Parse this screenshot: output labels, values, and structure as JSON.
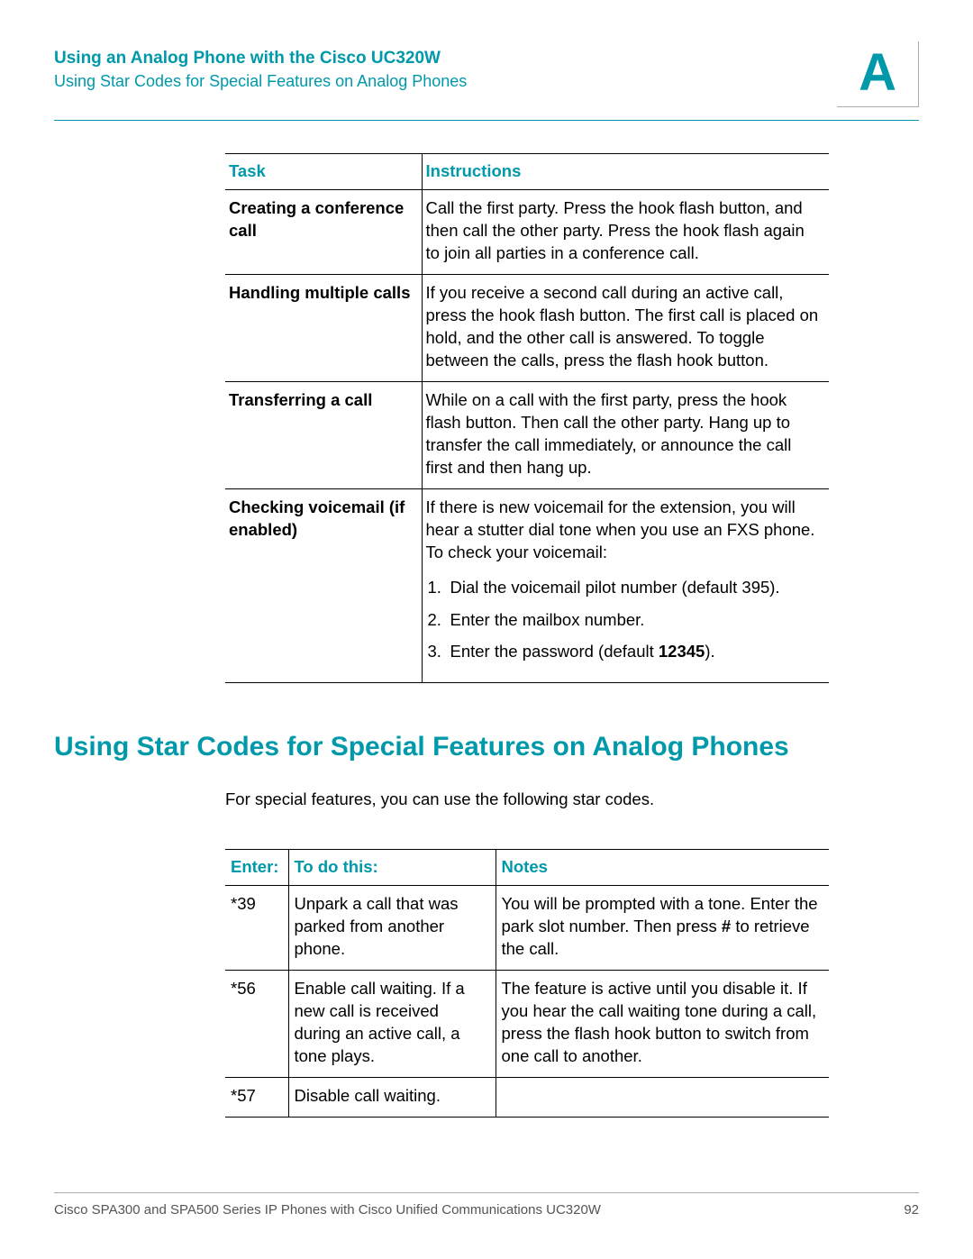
{
  "header": {
    "title": "Using an Analog Phone with the Cisco UC320W",
    "subtitle": "Using Star Codes for Special Features on Analog Phones",
    "appendix": "A"
  },
  "table1": {
    "head_task": "Task",
    "head_instr": "Instructions",
    "rows": [
      {
        "task": "Creating a conference call",
        "instr": "Call the first party. Press the hook flash button, and then call the other party. Press the hook flash again to join all parties in a conference call."
      },
      {
        "task": "Handling multiple calls",
        "instr": "If you receive a second call during an active call, press the hook flash button. The first call is placed on hold, and the other call is answered. To toggle between the calls, press the flash hook button."
      },
      {
        "task": "Transferring a call",
        "instr": "While on a call with the first party, press the hook flash button. Then call the other party. Hang up to transfer the call immediately, or announce the call first and then hang up."
      },
      {
        "task": "Checking voicemail (if enabled)",
        "instr_intro": "If there is new voicemail for the extension, you will hear a stutter dial tone when you use an FXS phone. To check your voicemail:",
        "steps": [
          "Dial the voicemail pilot number (default 395).",
          "Enter the mailbox number.",
          "Enter the password (default "
        ],
        "step3_bold": "12345",
        "step3_tail": ")."
      }
    ]
  },
  "section_heading": "Using Star Codes for Special Features on Analog Phones",
  "intro": "For special features, you can use the following star codes.",
  "table2": {
    "head_enter": "Enter:",
    "head_todo": "To do this:",
    "head_notes": "Notes",
    "rows": [
      {
        "enter": "*39",
        "todo": "Unpark a call that was parked from another phone.",
        "notes_pre": "You will be prompted with a tone. Enter the park slot number. Then press ",
        "notes_key": "#",
        "notes_post": " to retrieve the call."
      },
      {
        "enter": "*56",
        "todo": "Enable call waiting. If a new call is received during an active call, a tone plays.",
        "notes": "The feature is active until you disable it. If you hear the call waiting tone during a call, press the flash hook button to switch from one call to another."
      },
      {
        "enter": "*57",
        "todo": "Disable call waiting.",
        "notes": ""
      }
    ]
  },
  "footer": {
    "left": "Cisco SPA300 and SPA500 Series IP Phones with Cisco Unified Communications UC320W",
    "page": "92"
  }
}
